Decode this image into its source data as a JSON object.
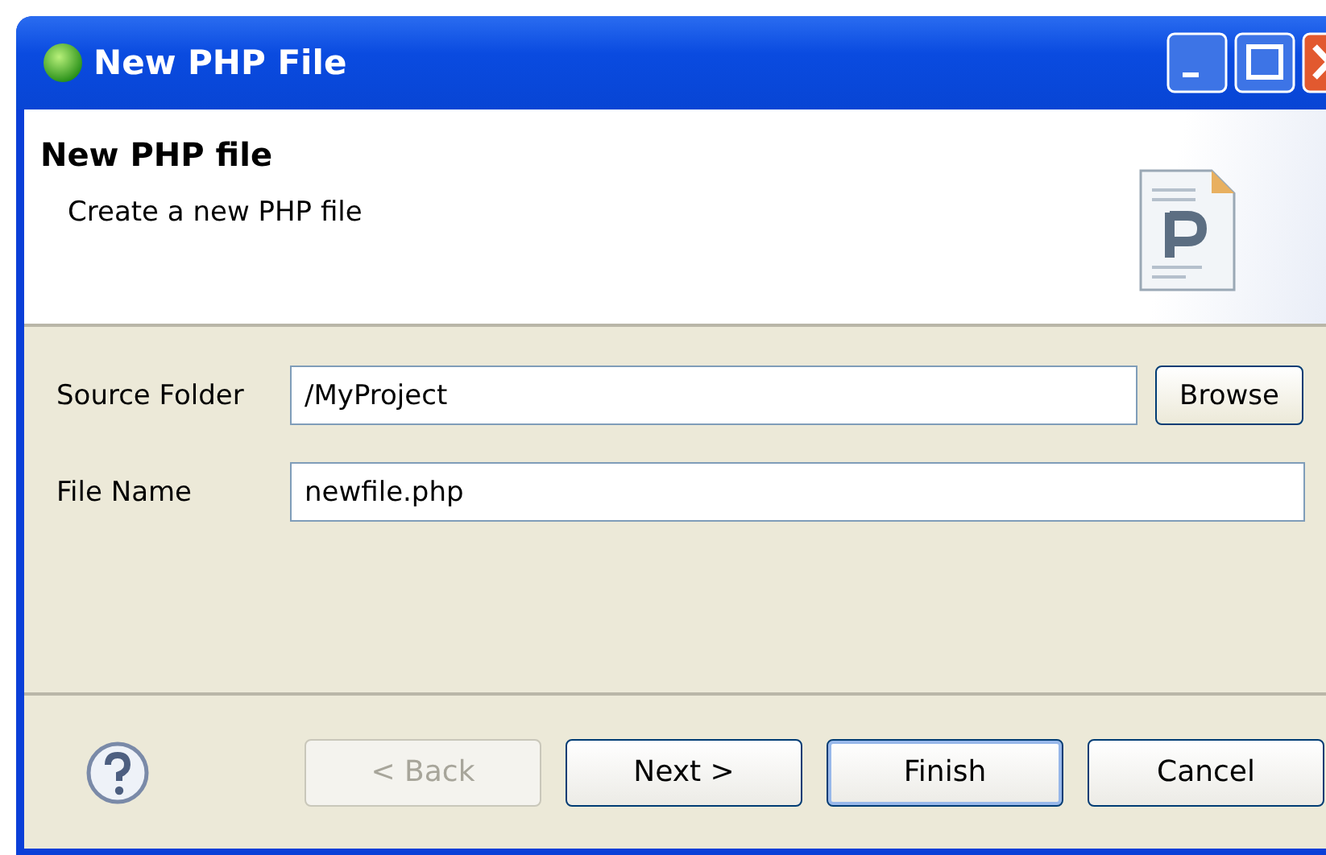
{
  "window": {
    "title": "New PHP File"
  },
  "header": {
    "title": "New PHP file",
    "description": "Create a new PHP file"
  },
  "fields": [
    {
      "label": "Source Folder",
      "value": "/MyProject",
      "button": "Browse"
    },
    {
      "label": "File Name",
      "value": "newfile.php"
    }
  ],
  "buttons": [
    {
      "label": "< Back",
      "disabled": true,
      "default": false
    },
    {
      "label": "Next >",
      "disabled": false,
      "default": false
    },
    {
      "label": "Finish",
      "disabled": false,
      "default": true
    },
    {
      "label": "Cancel",
      "disabled": false,
      "default": false
    }
  ]
}
